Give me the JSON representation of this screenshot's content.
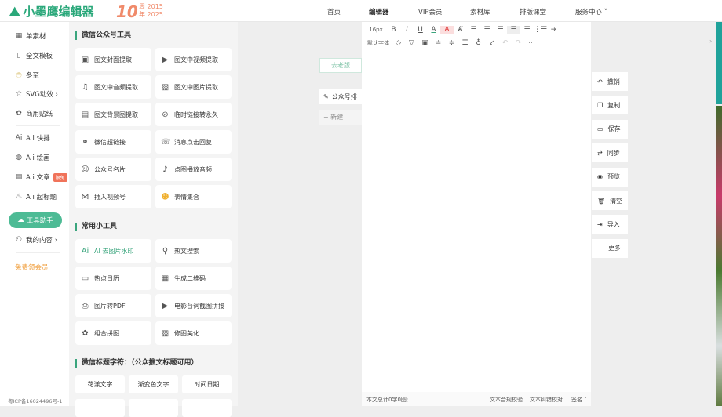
{
  "header": {
    "logo": "小墨鹰编辑器",
    "anniv_num": "10",
    "anniv_years": [
      "周 2015",
      "年 2025"
    ],
    "nav": [
      "首页",
      "编辑器",
      "VIP会员",
      "素材库",
      "排版课堂",
      "服务中心 ˅"
    ]
  },
  "leftnav": {
    "items": [
      "单素材",
      "全文模板",
      "冬至",
      "SVG动效 ›",
      "商用贴纸",
      "A i 快排",
      "A i 绘画",
      "A i 文章",
      "A i 起标题",
      "工具助手",
      "我的内容 ›",
      "免费领会员"
    ],
    "badge": "限免",
    "icp": "粤ICP备16024496号-1"
  },
  "tools": {
    "sec1": "微信公众号工具",
    "sec1_items": [
      "图文封面提取",
      "图文中视频提取",
      "图文中音频提取",
      "图文中图片提取",
      "图文背景图提取",
      "临时链接转永久",
      "微信超链接",
      "消息点击回复",
      "公众号名片",
      "点图播放音频",
      "插入视频号",
      "表情集合"
    ],
    "sec2": "常用小工具",
    "sec2_items": [
      "AI 去图片水印",
      "热文搜索",
      "热点日历",
      "生成二维码",
      "图片转PDF",
      "电影台词截图拼接",
      "组合拼图",
      "修图美化"
    ],
    "sec3": "微信标题字符：（公众推文标题可用）",
    "sec3_items": [
      "花漾文字",
      "渐变色文字",
      "时间日期"
    ]
  },
  "editor": {
    "font_size": "16px",
    "font_family": "默认字体",
    "old_version": "去老版",
    "doc_tab": "公众号排",
    "new": "+ 新建",
    "footer": {
      "count": "本文总计0字0图;",
      "check1": "文本合规校验",
      "check2": "文本纠错校对",
      "sign": "签名 ˄"
    }
  },
  "actions": [
    "撤销",
    "复制",
    "保存",
    "同步",
    "预览",
    "清空",
    "导入",
    "更多"
  ]
}
